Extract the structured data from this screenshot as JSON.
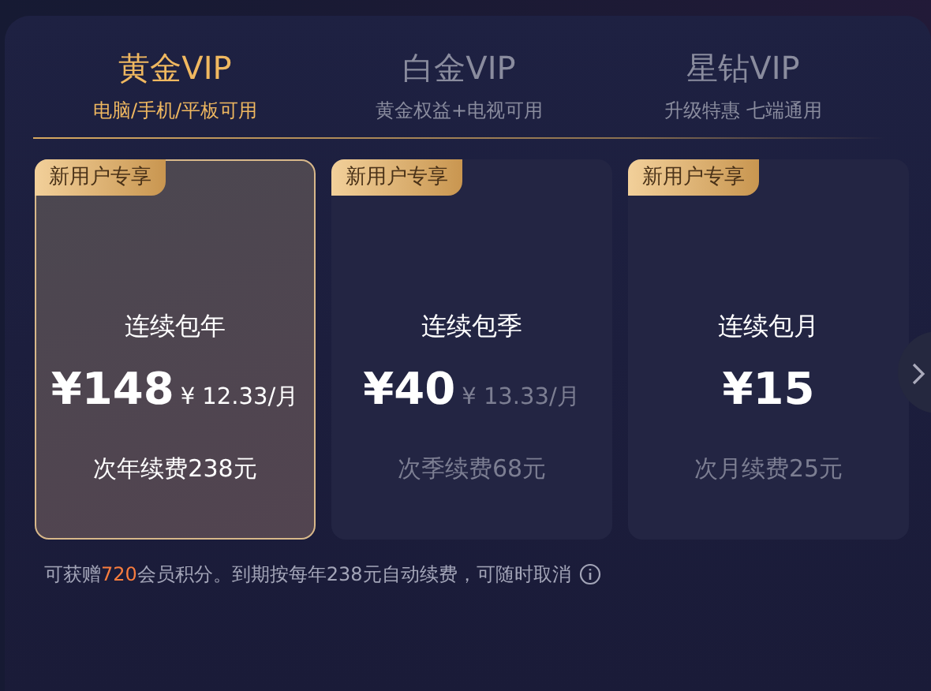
{
  "tabs": [
    {
      "title": "黄金VIP",
      "subtitle": "电脑/手机/平板可用",
      "selected": true
    },
    {
      "title": "白金VIP",
      "subtitle": "黄金权益+电视可用",
      "selected": false
    },
    {
      "title": "星钻VIP",
      "subtitle": "升级特惠 七端通用",
      "selected": false
    }
  ],
  "plans": [
    {
      "badge": "新用户专享",
      "name": "连续包年",
      "price": "¥148",
      "per_month": "¥ 12.33/月",
      "renewal": "次年续费238元",
      "selected": true
    },
    {
      "badge": "新用户专享",
      "name": "连续包季",
      "price": "¥40",
      "per_month": "¥ 13.33/月",
      "renewal": "次季续费68元",
      "selected": false
    },
    {
      "badge": "新用户专享",
      "name": "连续包月",
      "price": "¥15",
      "renewal": "次月续费25元",
      "selected": false
    }
  ],
  "note": [
    {
      "text": "可获赠",
      "highlight": false
    },
    {
      "text": "720",
      "highlight": true
    },
    {
      "text": "会员积分。到期按每年238元自动续费，可随时取消",
      "highlight": false
    }
  ]
}
